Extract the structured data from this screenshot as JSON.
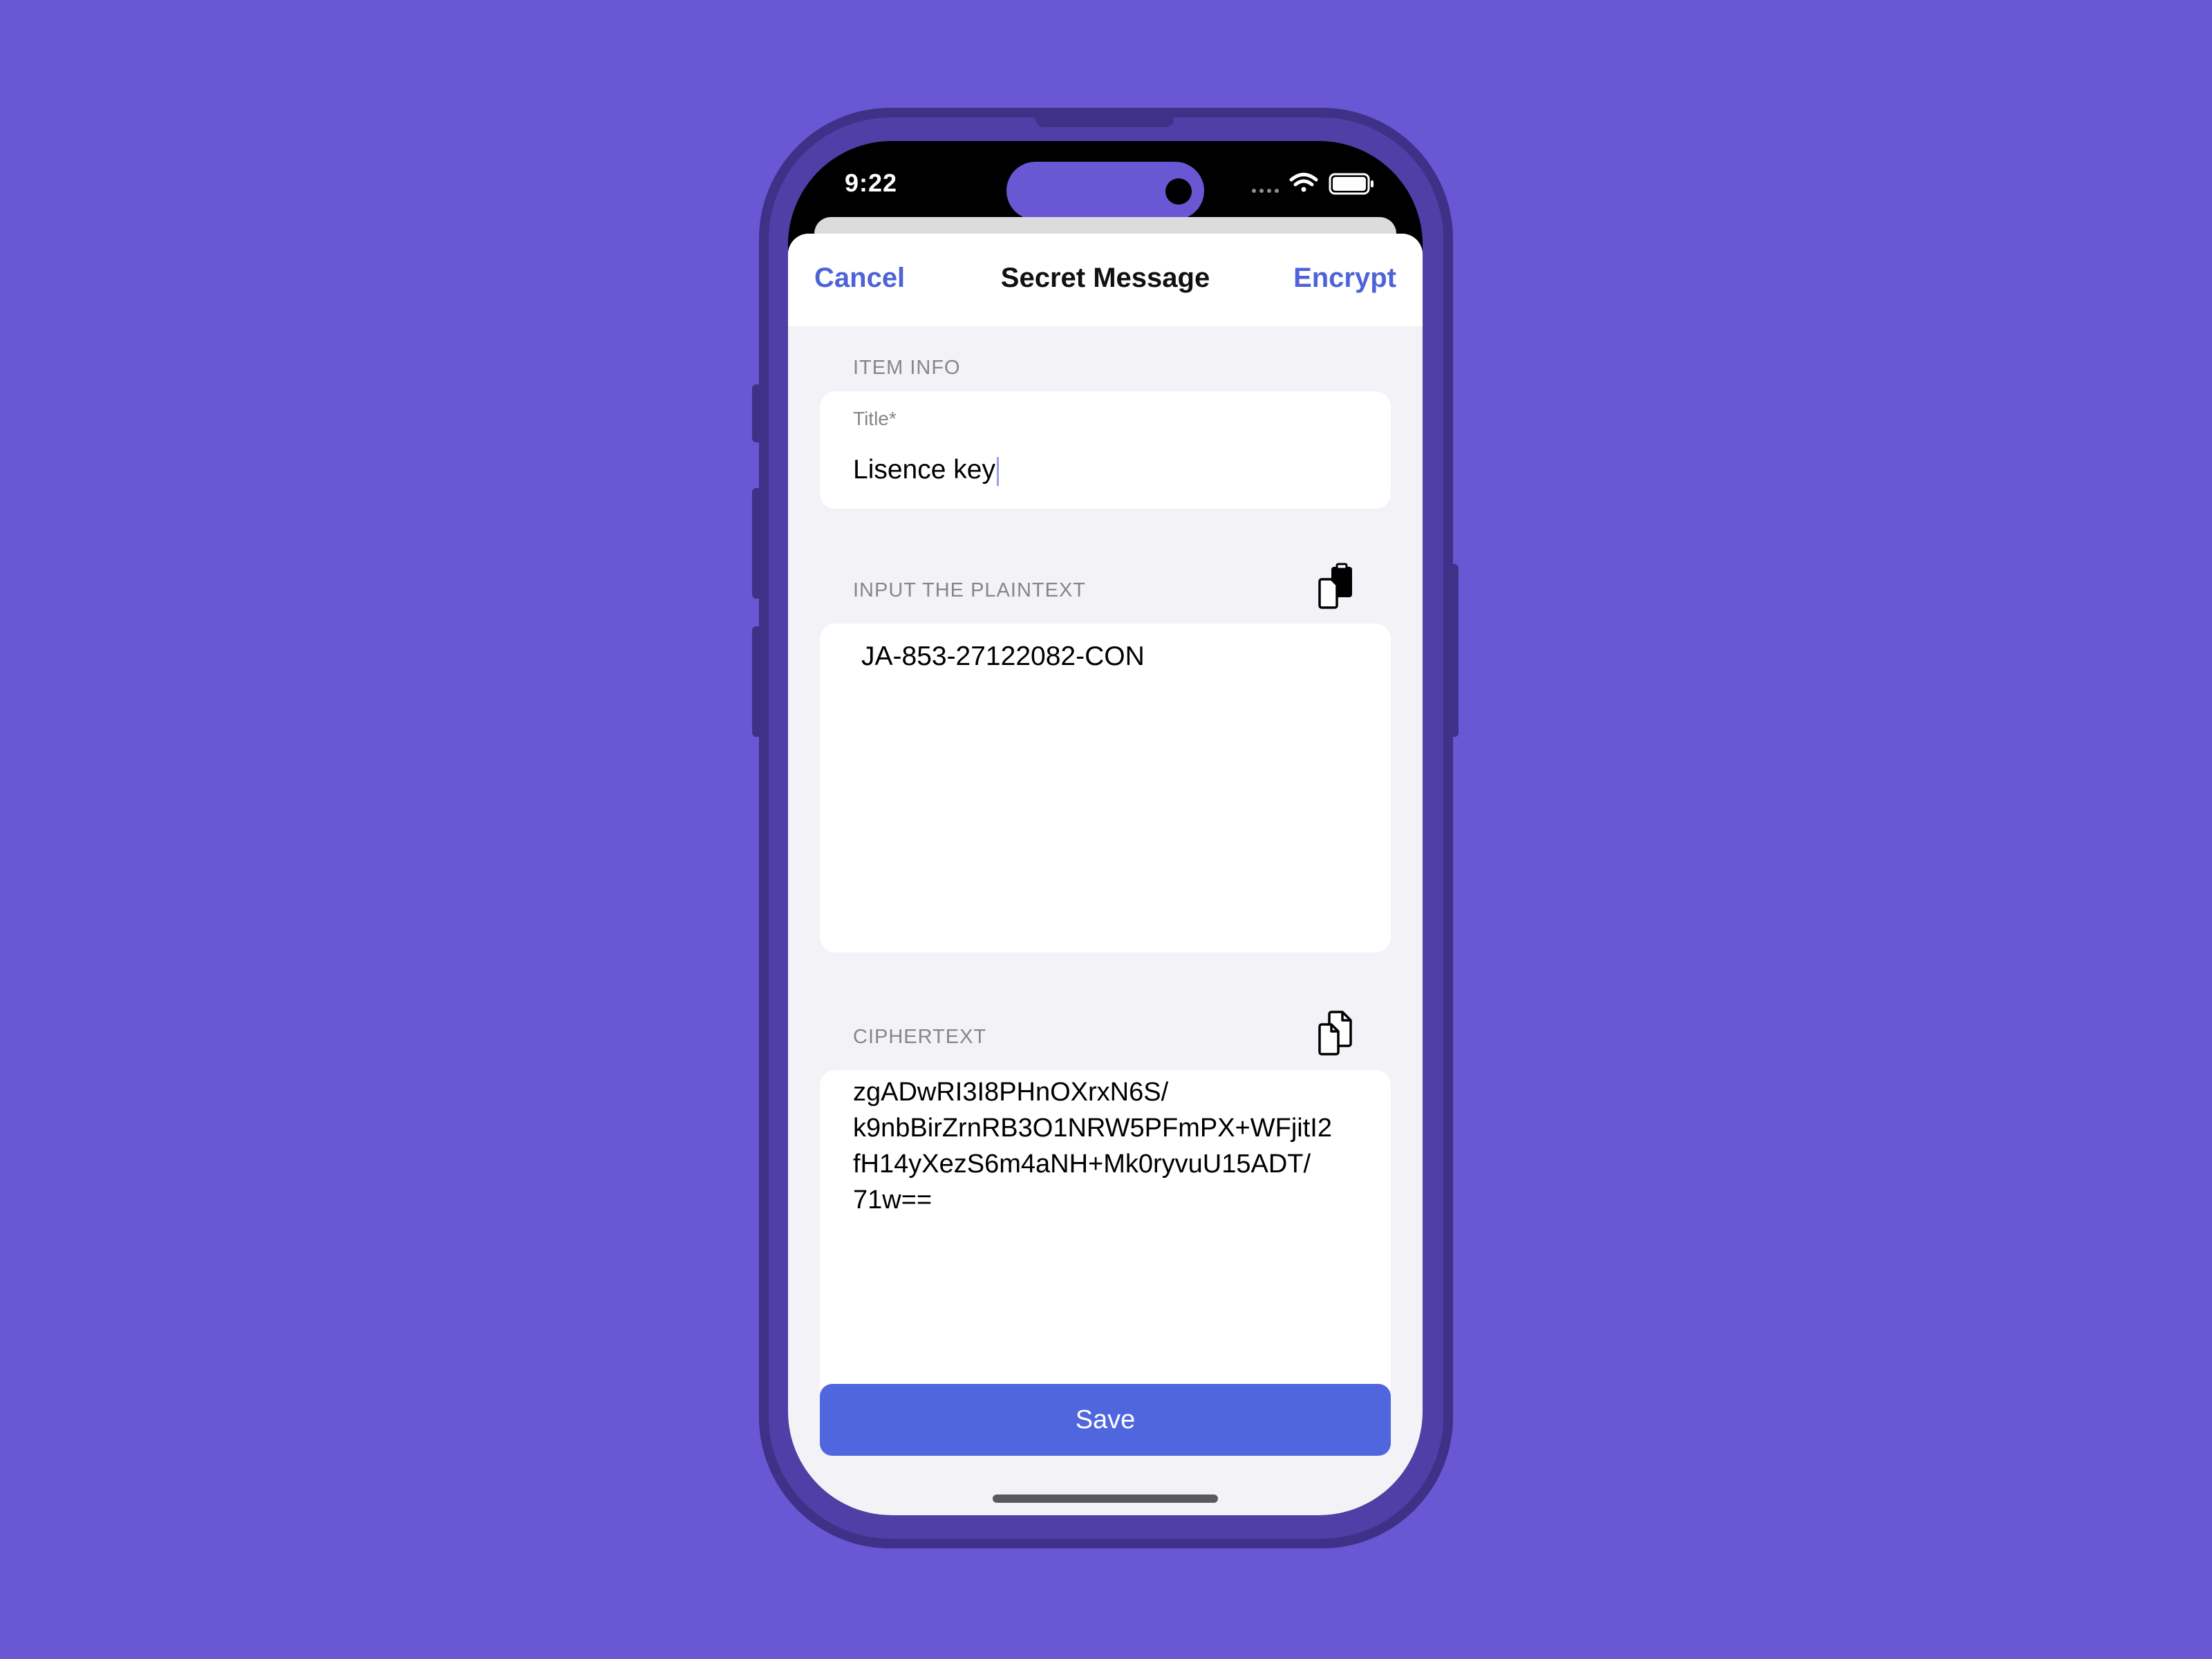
{
  "status_bar": {
    "time": "9:22"
  },
  "nav": {
    "cancel_label": "Cancel",
    "title": "Secret Message",
    "encrypt_label": "Encrypt"
  },
  "item_info": {
    "section_label": "ITEM INFO",
    "title_field_label": "Title*",
    "title_value": "Lisence key"
  },
  "plaintext": {
    "section_label": "INPUT THE PLAINTEXT",
    "value": "JA-853-27122082-CON",
    "paste_icon": "paste-clipboard-icon"
  },
  "ciphertext": {
    "section_label": "CIPHERTEXT",
    "value": "zgADwRI3I8PHnOXrxN6S/\nk9nbBirZrnRB3O1NRW5PFmPX+WFjitI2\nfH14yXezS6m4aNH+Mk0ryvuU15ADT/\n71w==",
    "copy_icon": "copy-documents-icon"
  },
  "save_label": "Save",
  "colors": {
    "background": "#6957D3",
    "accent": "#5066DF",
    "nav_link": "#4F63D8"
  }
}
